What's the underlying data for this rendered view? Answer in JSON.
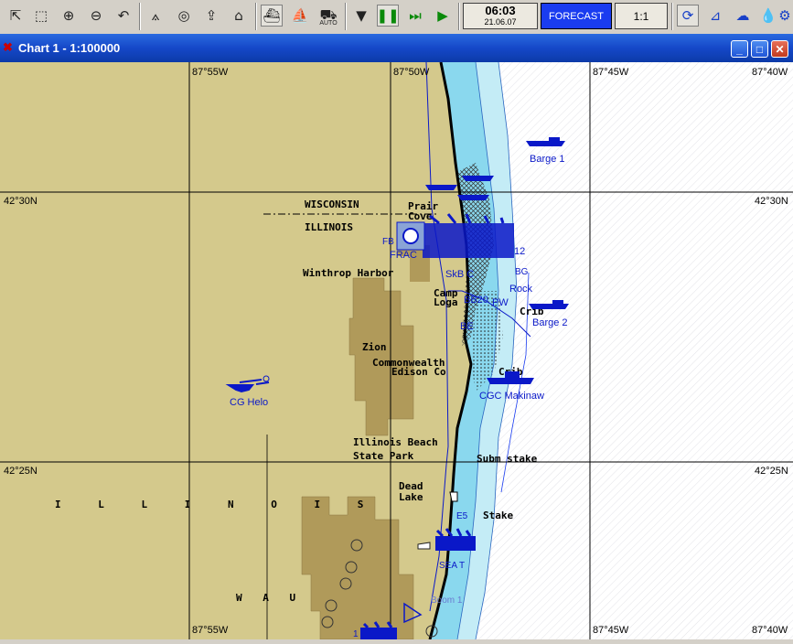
{
  "toolbar": {
    "clock_time": "06:03",
    "clock_date": "21.06.07",
    "forecast_label": "FORECAST",
    "scale_label": "1:1",
    "auto_label": "AUTO"
  },
  "window": {
    "title": "Chart 1 - 1:100000"
  },
  "chart": {
    "grid": {
      "lon_labels": [
        "87°55W",
        "87°50W",
        "87°45W",
        "87°40W"
      ],
      "lat_labels": [
        "42°30N",
        "42°25N"
      ]
    },
    "place_labels": {
      "wisconsin": "WISCONSIN",
      "illinois_state": "ILLINOIS",
      "prairie": "Prair",
      "cove": "Cove",
      "winthrop_harbor": "Winthrop Harbor",
      "camp_logan_1": "Camp",
      "camp_logan_2": "Loga",
      "zion": "Zion",
      "commonwealth": "Commonwealth",
      "edison": "Edison Co",
      "crib_upper": "Crib",
      "crib_lower": "Crib",
      "illinois_beach": "Illinois Beach",
      "state_park": "State Park",
      "subm_stake": "Subm stake",
      "dead": "Dead",
      "lake": "Lake",
      "stake": "Stake",
      "illinois_spaced": "I L L I N O I S",
      "wau": "W A U"
    },
    "object_labels": {
      "barge1": "Barge 1",
      "barge2": "Barge 2",
      "cg_helo": "CG Helo",
      "cgc_makinaw": "CGC Makinaw",
      "frac": "FRAC",
      "fb": "FB",
      "skb": "SkB C",
      "bb20": "BB20",
      "pw": "PW",
      "be": "BE",
      "rock": "Rock",
      "n12": "12",
      "bg": "BG",
      "e5": "E5",
      "boom1": "Boom 1",
      "seat": "SEA T",
      "n1": "1"
    },
    "colors": {
      "land": "#d4c98c",
      "urban": "#b09a5a",
      "water_deep": "#ffffff",
      "water_shallow": "#8ad8ee",
      "water_mid": "#c4ecf6",
      "object_blue": "#0a18c8",
      "grid": "#000000"
    }
  }
}
